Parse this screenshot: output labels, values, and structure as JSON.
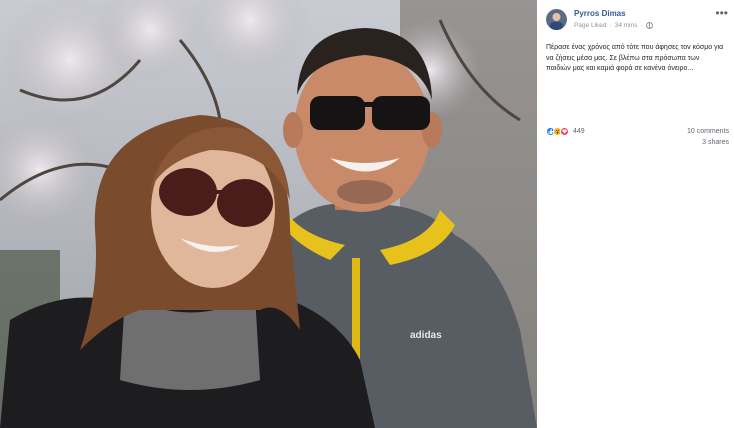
{
  "post": {
    "author": "Pyrros Dimas",
    "source": "Page Liked",
    "separator": "·",
    "time": "34 mins",
    "more_label": "•••",
    "text": "Πέρασε ένας χρόνος από τότε που άφησες τον κόσμο για να ζήσεις μέσα μας. Σε βλέπω στα πρόσωπα των παιδιών μας και καμιά φορά σε κανένα όνειρο...",
    "reaction_count": "449",
    "comments": "10 comments",
    "shares": "3 shares",
    "photo_logo_text": "adidas"
  },
  "colors": {
    "link": "#385898",
    "meta": "#90949c",
    "like": "#1877f2",
    "wow": "#f7b125",
    "love": "#f33e58"
  },
  "icons": {
    "privacy": "globe-icon",
    "options": "more-options-icon",
    "like": "like-reaction-icon",
    "wow": "wow-reaction-icon",
    "love": "love-reaction-icon"
  }
}
